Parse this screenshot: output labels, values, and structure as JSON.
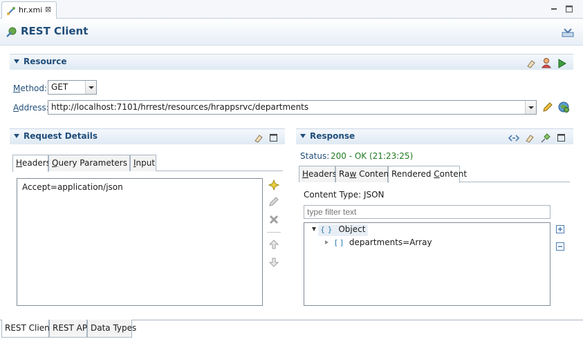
{
  "editor_tab": {
    "label": "hr.xmi",
    "close": "⊠"
  },
  "form": {
    "title": "REST Client"
  },
  "resource": {
    "title": "Resource",
    "method_label_u": "M",
    "method_label_rest": "ethod:",
    "method_value": "GET",
    "address_label_u": "A",
    "address_label_rest": "ddress:",
    "address_value": "http://localhost:7101/hrrest/resources/hrappsrvc/departments"
  },
  "request": {
    "title": "Request Details",
    "tabs": [
      {
        "u": "H",
        "rest": "eaders"
      },
      {
        "u": "Q",
        "rest": "uery Parameters"
      },
      {
        "u": "I",
        "rest": "nput"
      }
    ],
    "headers": [
      "Accept=application/json"
    ]
  },
  "response": {
    "title": "Response",
    "status_label": "Status:",
    "status_value": "200 - OK (21:23:25)",
    "status_color": "#1f7a1f",
    "tabs": [
      {
        "u": "H",
        "rest": "eaders"
      },
      {
        "pre": "Ra",
        "u": "w",
        "rest": " Content"
      },
      {
        "pre": "Rendered ",
        "u": "C",
        "rest": "ontent"
      }
    ],
    "content_type": "Content Type: JSON",
    "filter_placeholder": "type filter text",
    "tree": [
      {
        "glyph": "{ }",
        "label": "Object"
      },
      {
        "glyph": "[ ]",
        "label": "departments=Array"
      }
    ]
  },
  "bottom_tabs": [
    "REST Client",
    "REST API",
    "Data Types"
  ],
  "colors": {
    "accent": "#214e7a"
  }
}
